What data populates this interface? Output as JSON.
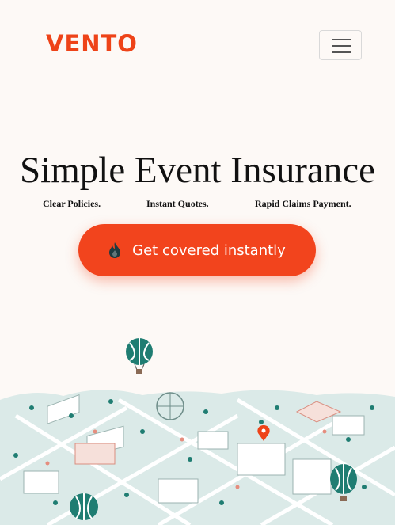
{
  "header": {
    "brand": "VENTO",
    "menu_icon": "hamburger-icon"
  },
  "hero": {
    "title": "Simple Event Insurance",
    "taglines": [
      "Clear Policies.",
      "Instant Quotes.",
      "Rapid Claims Payment."
    ],
    "cta_label": "Get covered instantly",
    "cta_icon": "flame-icon"
  },
  "colors": {
    "brand": "#ee4318",
    "cta_background": "#f2441d",
    "balloon": "#1f7d72",
    "map_background": "#dbeae8"
  }
}
